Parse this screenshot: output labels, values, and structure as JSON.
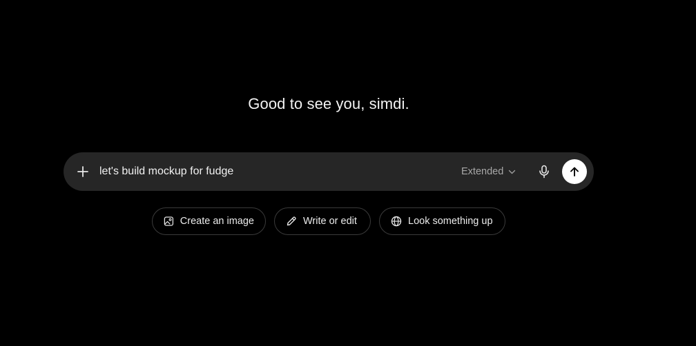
{
  "greeting": "Good to see you, simdi.",
  "composer": {
    "input_value": "let's build mockup for fudge",
    "model_label": "Extended",
    "icons": {
      "add": "plus-icon",
      "model_dropdown": "chevron-down-icon",
      "voice": "microphone-icon",
      "send": "arrow-up-icon"
    }
  },
  "suggestions": [
    {
      "label": "Create an image",
      "icon": "image-icon"
    },
    {
      "label": "Write or edit",
      "icon": "pencil-icon"
    },
    {
      "label": "Look something up",
      "icon": "globe-icon"
    }
  ],
  "colors": {
    "background": "#000000",
    "composer_bg": "#262626",
    "chip_border": "#3b3b3b",
    "send_button": "#ffffff"
  }
}
